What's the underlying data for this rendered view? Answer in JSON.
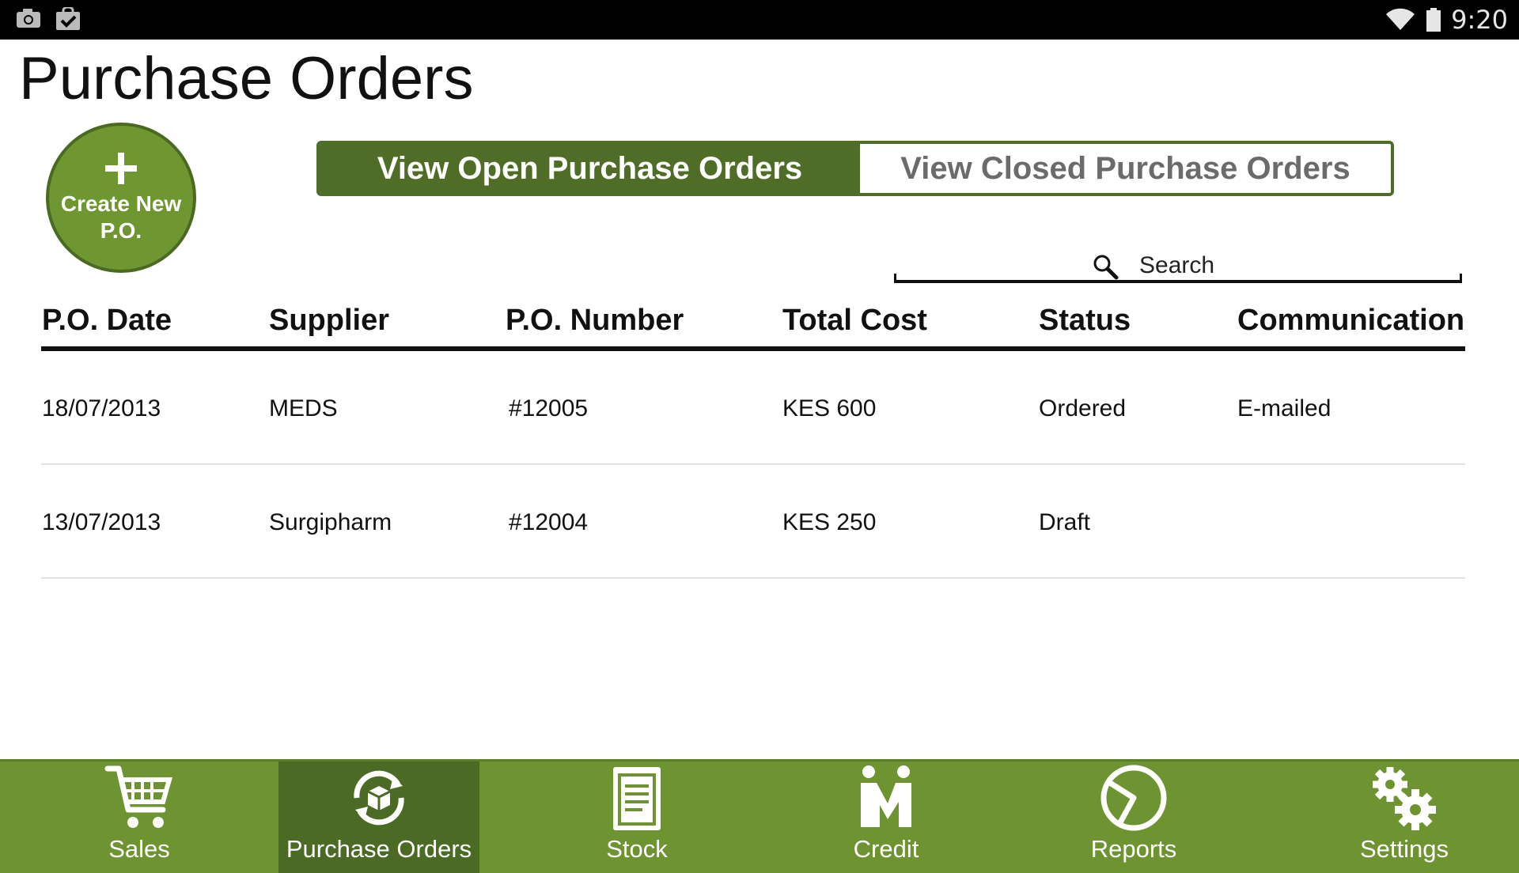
{
  "status_bar": {
    "time": "9:20"
  },
  "page": {
    "title": "Purchase Orders"
  },
  "create_button": {
    "label": "Create New P.O."
  },
  "tabs": {
    "open_label": "View Open Purchase Orders",
    "closed_label": "View Closed Purchase Orders",
    "active": "open"
  },
  "search": {
    "placeholder": "Search"
  },
  "table": {
    "headers": [
      "P.O. Date",
      "Supplier",
      "P.O. Number",
      "Total Cost",
      "Status",
      "Communication"
    ],
    "rows": [
      [
        "18/07/2013",
        "MEDS",
        "#12005",
        "KES 600",
        "Ordered",
        "E-mailed"
      ],
      [
        "13/07/2013",
        "Surgipharm",
        "#12004",
        "KES 250",
        "Draft",
        ""
      ]
    ]
  },
  "nav": {
    "items": [
      {
        "label": "Sales",
        "icon": "cart-icon"
      },
      {
        "label": "Purchase Orders",
        "icon": "box-cycle-icon",
        "active": true
      },
      {
        "label": "Stock",
        "icon": "clipboard-icon"
      },
      {
        "label": "Credit",
        "icon": "people-icon"
      },
      {
        "label": "Reports",
        "icon": "pie-chart-icon"
      },
      {
        "label": "Settings",
        "icon": "gears-icon"
      }
    ]
  },
  "colors": {
    "brand_green": "#6e9431",
    "dark_green": "#4f6d26",
    "text": "#111111"
  }
}
